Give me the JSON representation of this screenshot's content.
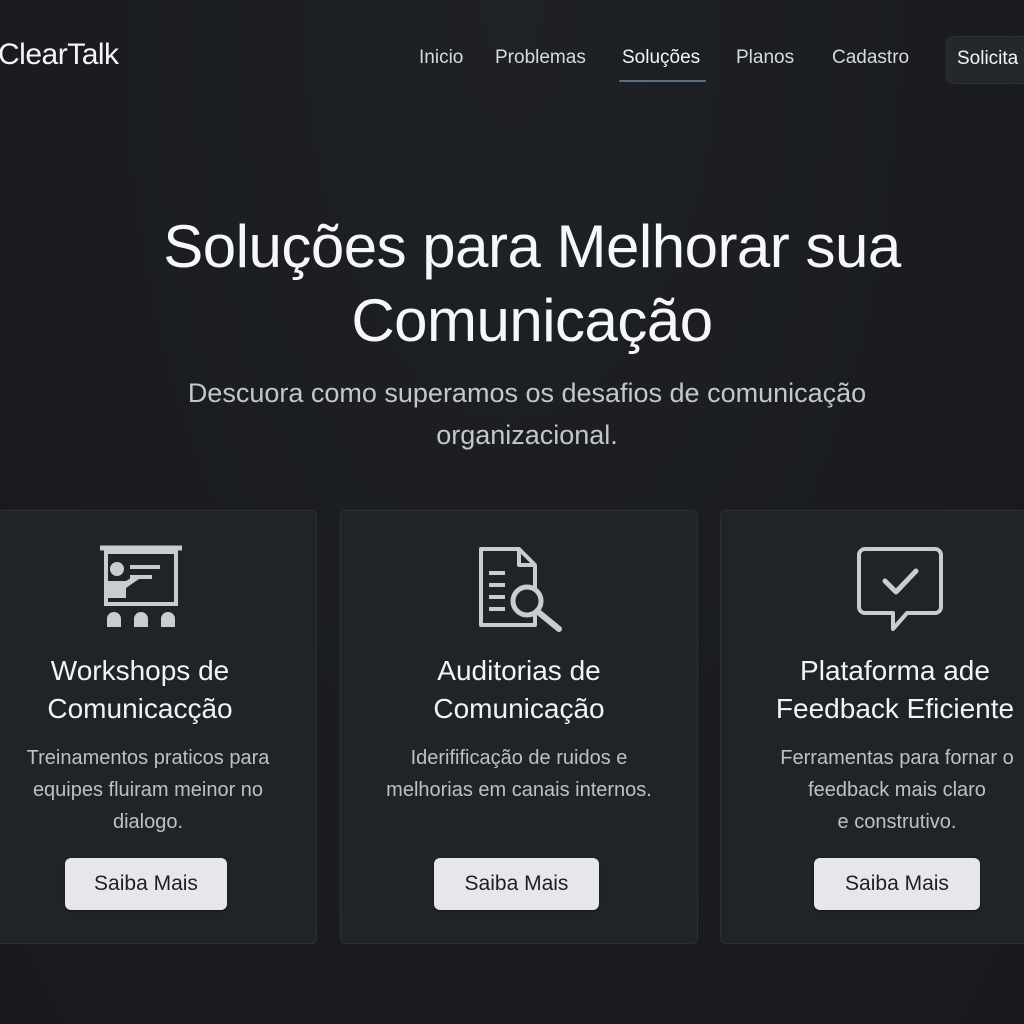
{
  "header": {
    "logo": "ClearTalk",
    "nav": [
      {
        "label": "Inicio",
        "active": false
      },
      {
        "label": "Problemas",
        "active": false
      },
      {
        "label": "Soluções",
        "active": true
      },
      {
        "label": "Planos",
        "active": false
      },
      {
        "label": "Cadastro",
        "active": false
      }
    ],
    "cta_label": "Solicita"
  },
  "hero": {
    "title": "Soluções para Melhorar sua Comunicação",
    "subtitle": "Descuora como superamos os desafios de comunicação organizacional."
  },
  "cards": [
    {
      "icon": "presentation-icon",
      "title": "Workshops de\nComunicacção",
      "description": "Treinamentos praticos para\nequipes fluiram meinor no\ndialogo.",
      "button_label": "Saiba Mais"
    },
    {
      "icon": "document-search-icon",
      "title": "Auditorias de\nComunicação",
      "description": "Iderifificação de ruidos e\nmelhorias em canais internos.",
      "button_label": "Saiba Mais"
    },
    {
      "icon": "chat-check-icon",
      "title": "Plataforma ade\nFeedback Eficiente",
      "description": "Ferramentas para fornar o\nfeedback mais claro\ne construtivo.",
      "button_label": "Saiba Mais"
    }
  ],
  "colors": {
    "background": "#1a1c20",
    "card": "#202328",
    "button": "#e6e7ea",
    "icon": "#c9ccd1",
    "nav_underline": "#5d6f80"
  }
}
